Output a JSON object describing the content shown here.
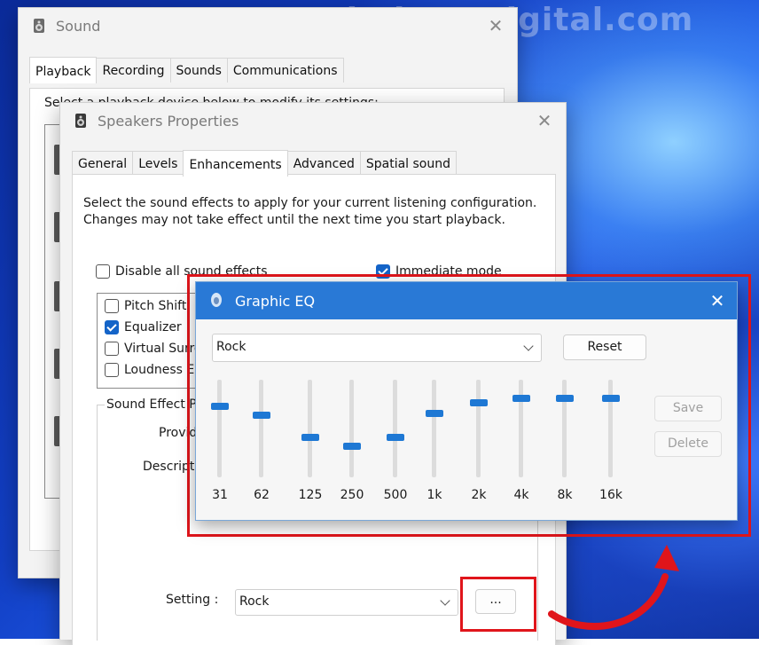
{
  "watermark": "WindowsDigital.com",
  "sound": {
    "title": "Sound",
    "tabs": [
      "Playback",
      "Recording",
      "Sounds",
      "Communications"
    ],
    "active_tab": "Playback",
    "description": "Select a playback device below to modify its settings:"
  },
  "speakers": {
    "title": "Speakers Properties",
    "tabs": [
      "General",
      "Levels",
      "Enhancements",
      "Advanced",
      "Spatial sound"
    ],
    "active_tab": "Enhancements",
    "description": "Select the sound effects to apply for your current listening configuration. Changes may not take effect until the next time you start playback.",
    "disable_all_label": "Disable all sound effects",
    "disable_all_checked": false,
    "immediate_label": "Immediate mode",
    "immediate_checked": true,
    "effects": [
      {
        "label": "Pitch Shift",
        "checked": false
      },
      {
        "label": "Equalizer",
        "checked": true
      },
      {
        "label": "Virtual Surround",
        "checked": false
      },
      {
        "label": "Loudness Equalization",
        "checked": false
      }
    ],
    "properties_legend": "Sound Effect Properties",
    "provider_label": "Provider",
    "description_label": "Description",
    "setting_label": "Setting :",
    "setting_value": "Rock",
    "more_button": "..."
  },
  "graphic_eq": {
    "title": "Graphic EQ",
    "preset": "Rock",
    "reset_label": "Reset",
    "save_label": "Save",
    "delete_label": "Delete",
    "bands": [
      {
        "label": "31",
        "level": 0.75
      },
      {
        "label": "62",
        "level": 0.65
      },
      {
        "label": "125",
        "level": 0.4
      },
      {
        "label": "250",
        "level": 0.3
      },
      {
        "label": "500",
        "level": 0.4
      },
      {
        "label": "1k",
        "level": 0.67
      },
      {
        "label": "2k",
        "level": 0.78
      },
      {
        "label": "4k",
        "level": 0.83
      },
      {
        "label": "8k",
        "level": 0.83
      },
      {
        "label": "16k",
        "level": 0.83
      }
    ]
  },
  "colors": {
    "accent": "#1E78D4",
    "eq_titlebar": "#2979D6",
    "highlight": "#E0151B"
  }
}
